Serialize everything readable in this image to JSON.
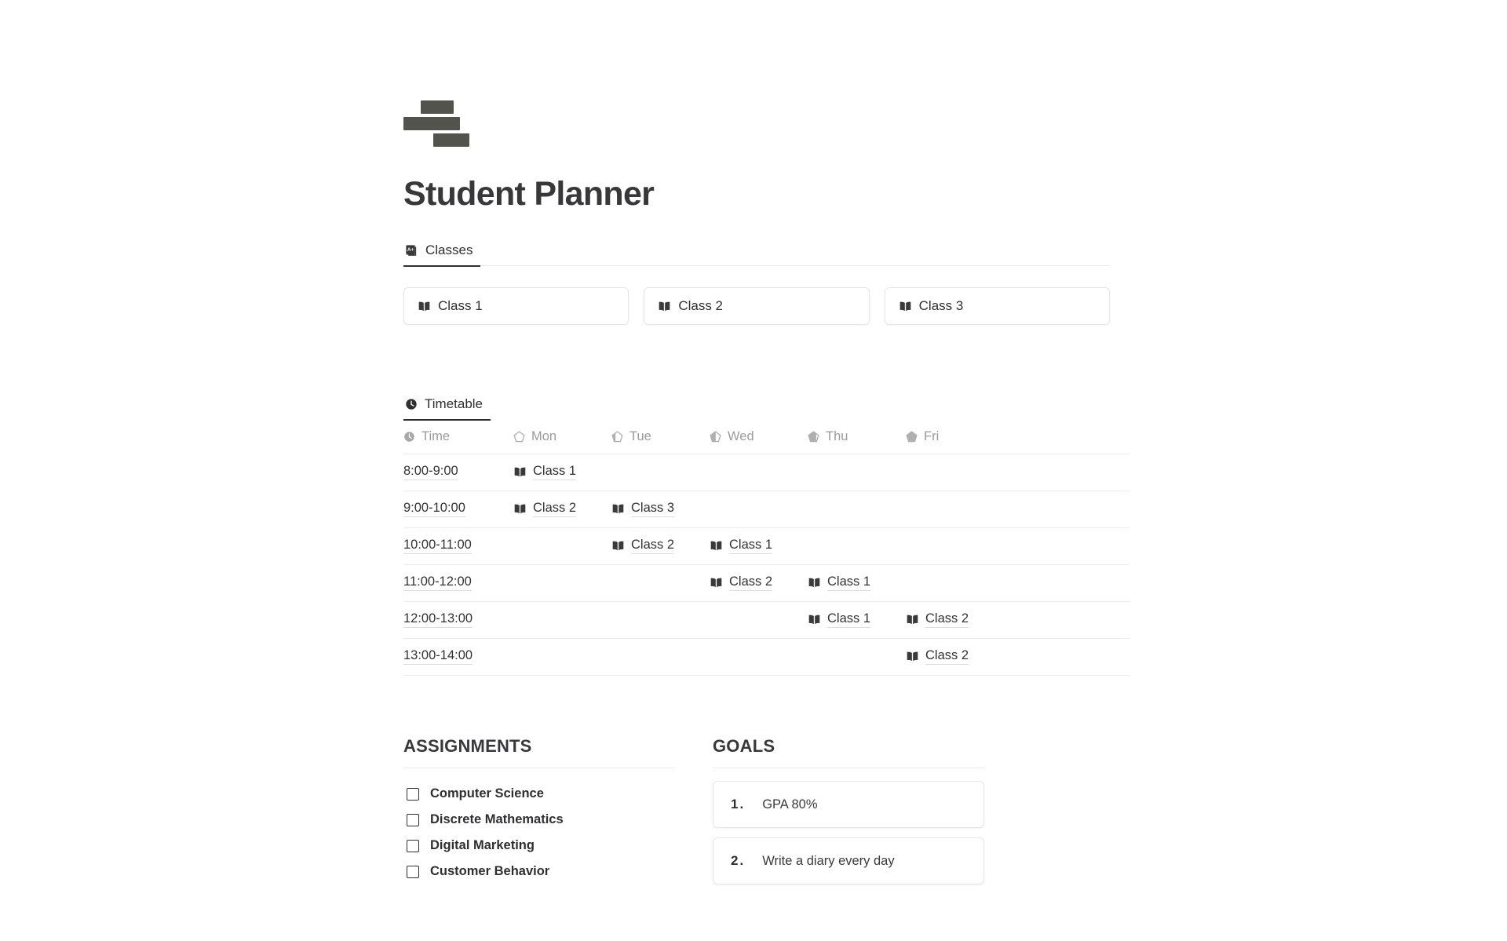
{
  "app": {
    "title": "Student Planner",
    "logo_icon": "stacked-bars-logo",
    "accent_color": "#53534d",
    "text_color": "#333333",
    "muted_color": "#9b9b9b",
    "border_color": "#ececec"
  },
  "classes_section": {
    "tab_label": "Classes",
    "tab_icon": "notebook-a-plus-icon",
    "cards": [
      {
        "label": "Class 1",
        "icon": "open-book-icon"
      },
      {
        "label": "Class 2",
        "icon": "open-book-icon"
      },
      {
        "label": "Class 3",
        "icon": "open-book-icon"
      }
    ]
  },
  "timetable_section": {
    "tab_label": "Timetable",
    "tab_icon": "clock-icon",
    "columns": [
      {
        "label": "Time",
        "icon": "clock-icon",
        "fill": 0.5
      },
      {
        "label": "Mon",
        "icon": "pentagon-battery-icon",
        "fill": 0.0
      },
      {
        "label": "Tue",
        "icon": "pentagon-battery-icon",
        "fill": 0.3
      },
      {
        "label": "Wed",
        "icon": "pentagon-battery-icon",
        "fill": 0.55
      },
      {
        "label": "Thu",
        "icon": "pentagon-battery-icon",
        "fill": 0.8
      },
      {
        "label": "Fri",
        "icon": "pentagon-battery-icon",
        "fill": 1.0
      }
    ],
    "rows": [
      {
        "time": "8:00-9:00",
        "mon": "Class 1",
        "tue": "",
        "wed": "",
        "thu": "",
        "fri": ""
      },
      {
        "time": "9:00-10:00",
        "mon": "Class 2",
        "tue": "Class 3",
        "wed": "",
        "thu": "",
        "fri": ""
      },
      {
        "time": "10:00-11:00",
        "mon": "",
        "tue": "Class 2",
        "wed": "Class 1",
        "thu": "",
        "fri": ""
      },
      {
        "time": "11:00-12:00",
        "mon": "",
        "tue": "",
        "wed": "Class 2",
        "thu": "Class 1",
        "fri": ""
      },
      {
        "time": "12:00-13:00",
        "mon": "",
        "tue": "",
        "wed": "",
        "thu": "Class 1",
        "fri": "Class 2"
      },
      {
        "time": "13:00-14:00",
        "mon": "",
        "tue": "",
        "wed": "",
        "thu": "",
        "fri": "Class 2"
      }
    ]
  },
  "assignments_section": {
    "heading": "ASSIGNMENTS",
    "items": [
      {
        "label": "Computer Science",
        "checked": false
      },
      {
        "label": "Discrete Mathematics",
        "checked": false
      },
      {
        "label": "Digital Marketing",
        "checked": false
      },
      {
        "label": "Customer Behavior",
        "checked": false
      }
    ]
  },
  "goals_section": {
    "heading": "GOALS",
    "items": [
      {
        "number": "1.",
        "text": "GPA 80%"
      },
      {
        "number": "2.",
        "text": "Write a diary every day"
      }
    ]
  }
}
